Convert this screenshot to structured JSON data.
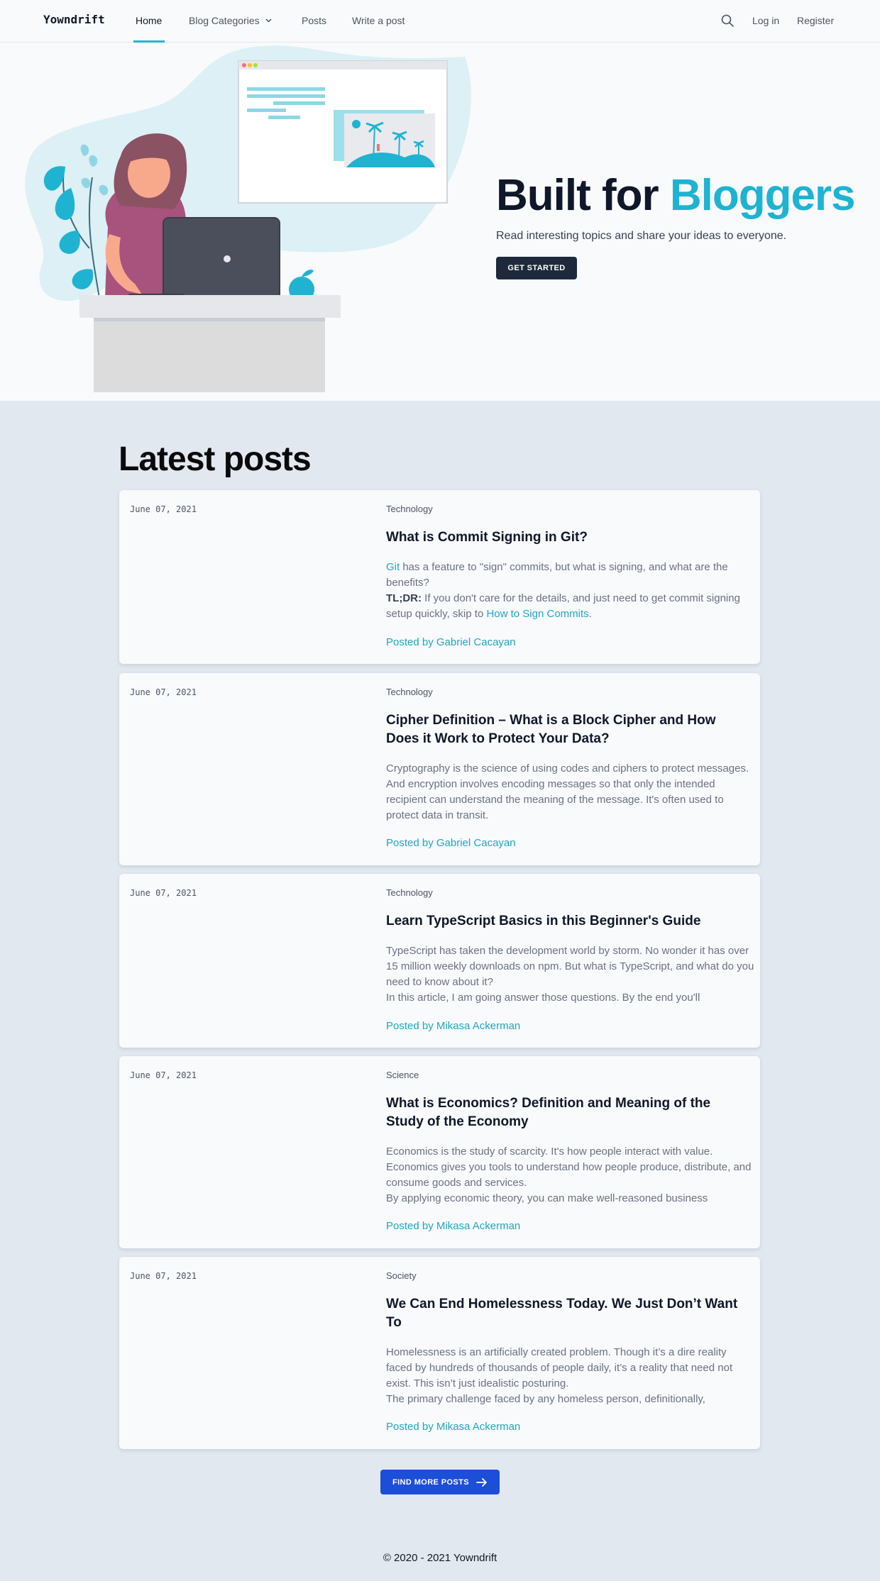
{
  "nav": {
    "brand": "Yowndrift",
    "links": [
      "Home",
      "Blog Categories",
      "Posts",
      "Write a post"
    ],
    "login": "Log in",
    "register": "Register",
    "search_icon": "search-icon",
    "accent_color": "#22b8cf"
  },
  "hero": {
    "title_main": "Built for ",
    "title_accent": "Bloggers",
    "subtitle": "Read interesting topics and share your ideas to everyone.",
    "cta": "GET STARTED",
    "accent_color": "#1fb3d2"
  },
  "latest": {
    "title": "Latest posts",
    "posts": [
      {
        "date": "June 07, 2021",
        "category": "Technology",
        "title": "What is Commit Signing in Git?",
        "excerpt_link": "Git",
        "excerpt_1": " has a feature to \"sign\" commits, but what is signing, and what are the benefits?",
        "excerpt_bold": "TL;DR:",
        "excerpt_2": " If you don't care for the details, and just need to get commit signing setup quickly, skip to ",
        "excerpt_link2": "How to Sign Commits",
        "excerpt_3": ".",
        "author": "Posted by Gabriel Cacayan"
      },
      {
        "date": "June 07, 2021",
        "category": "Technology",
        "title": "Cipher Definition – What is a Block Cipher and How Does it Work to Protect Your Data?",
        "excerpt": "Cryptography is the science of using codes and ciphers to protect messages. And encryption involves encoding messages so that only the intended recipient can understand the meaning of the message. It's often used to protect data in transit.",
        "author": "Posted by Gabriel Cacayan"
      },
      {
        "date": "June 07, 2021",
        "category": "Technology",
        "title": "Learn TypeScript Basics in this Beginner's Guide",
        "excerpt": "TypeScript has taken the development world by storm. No wonder it has over 15 million weekly downloads on npm. But what is TypeScript, and what do you need to know about it?",
        "excerpt_2": "In this article, I am going answer those questions. By the end you'll",
        "author": "Posted by Mikasa Ackerman"
      },
      {
        "date": "June 07, 2021",
        "category": "Science",
        "title": "What is Economics? Definition and Meaning of the Study of the Economy",
        "excerpt": "Economics is the study of scarcity. It's how people interact with value. Economics gives you tools to understand how people produce, distribute, and consume goods and services.",
        "excerpt_2": "By applying economic theory, you can make well-reasoned business",
        "author": "Posted by Mikasa Ackerman"
      },
      {
        "date": "June 07, 2021",
        "category": "Society",
        "title": "We Can End Homelessness Today. We Just Don’t Want To",
        "excerpt": "Homelessness is an artificially created problem. Though it’s a dire reality faced by hundreds of thousands of people daily, it’s a reality that need not exist. This isn’t just idealistic posturing.",
        "excerpt_2": "The primary challenge faced by any homeless person, definitionally,",
        "author": "Posted by Mikasa Ackerman"
      }
    ],
    "more_button": "FIND MORE POSTS",
    "more_icon": "arrow-right-icon",
    "button_color": "#1d4ed8"
  },
  "footer": {
    "copyright": "© 2020 - 2021 Yowndrift"
  }
}
